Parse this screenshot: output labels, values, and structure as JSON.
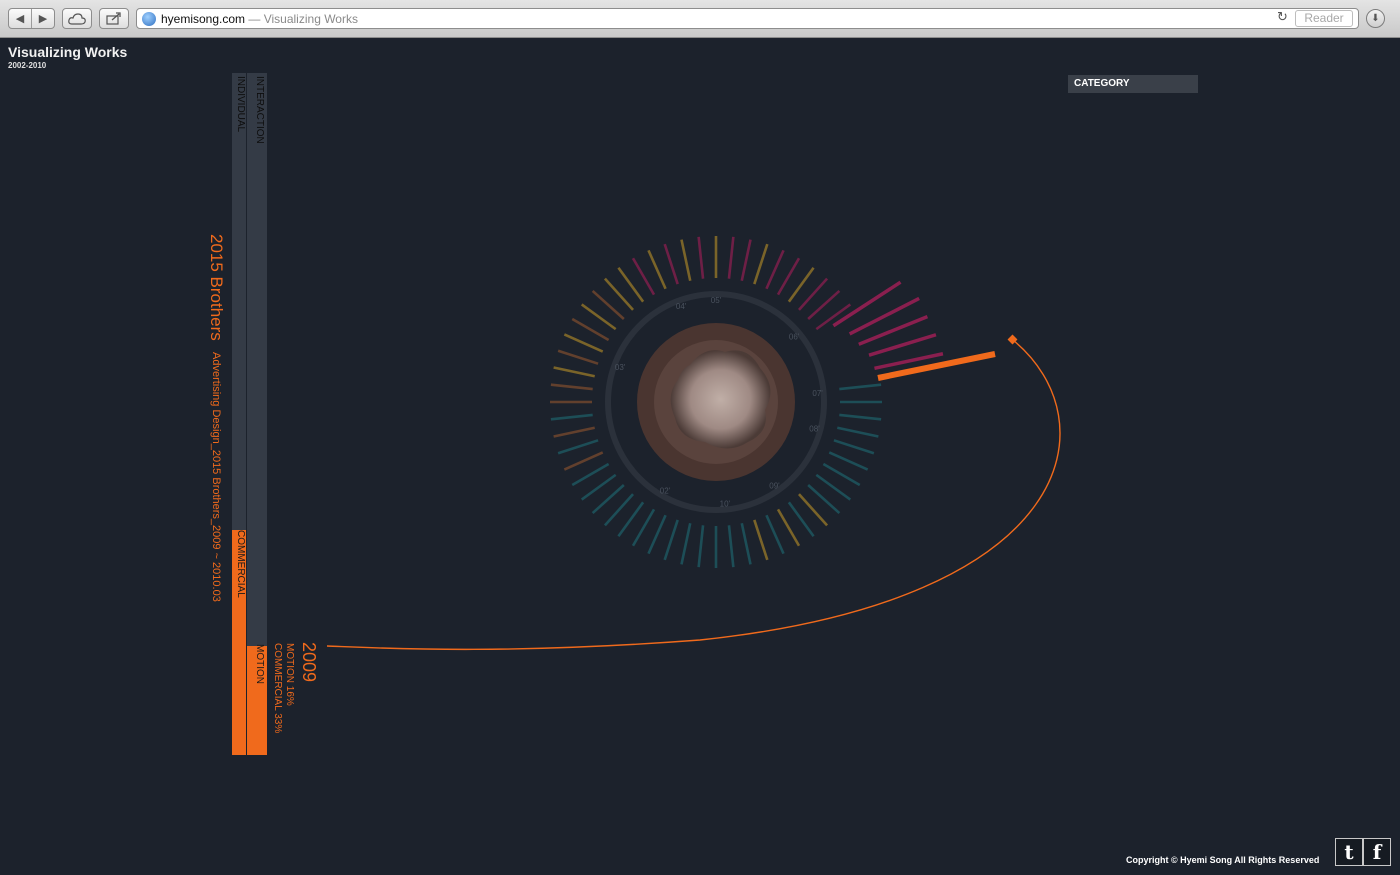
{
  "browser": {
    "domain": "hyemisong.com",
    "title_suffix": " — Visualizing Works",
    "reader_label": "Reader"
  },
  "page": {
    "title": "Visualizing Works",
    "years": "2002-2010"
  },
  "category": {
    "label": "CATEGORY"
  },
  "category_bars": [
    {
      "label": "INDIVIDUAL",
      "fill_label": "COMMERCIAL",
      "fill_fraction": 0.33
    },
    {
      "label": "INTERACTION",
      "fill_label": "MOTION",
      "fill_fraction": 0.16
    }
  ],
  "project": {
    "name": "2015 Brothers",
    "description": "Advertising Design_2015 Brothers_2009 ~ 2010.03"
  },
  "year_summary": {
    "year": "2009",
    "motion": "MOTION 16%",
    "commercial": "COMMERCIAL 33%"
  },
  "dial_labels": [
    "05'",
    "06'",
    "07'",
    "08'",
    "09'",
    "10'",
    "02'",
    "03'",
    "04'"
  ],
  "colors": {
    "background": "#1c222c",
    "accent": "#f06a1c",
    "bar_bg": "#343b46",
    "magenta": "#8a1f4f",
    "gold": "#9a7a28",
    "teal": "#1e5d66",
    "brown": "#7a4a2e",
    "violet": "#5a2a6a"
  },
  "footer": {
    "copyright": "Copyright © Hyemi Song All Rights Reserved",
    "twitter_icon": "twitter-icon",
    "facebook_icon": "facebook-icon"
  }
}
